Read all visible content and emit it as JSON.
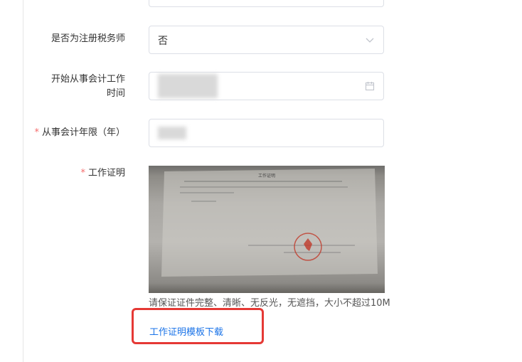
{
  "form": {
    "tax_agent": {
      "label": "是否为注册税务师",
      "value": "否",
      "icon": "chevron-down-icon"
    },
    "start_date": {
      "label_line1": "开始从事会计工作",
      "label_line2": "时间",
      "icon": "calendar-icon"
    },
    "years": {
      "required_mark": "*",
      "label": "从事会计年限（年）"
    },
    "work_cert": {
      "required_mark": "*",
      "label": "工作证明",
      "photo_title": "工作证明",
      "hint": "请保证证件完整、清晰、无反光，无遮挡，大小不超过10M",
      "template_link": "工作证明模板下载"
    }
  },
  "colors": {
    "required": "#f56c6c",
    "link": "#1a73e8",
    "highlight_box": "#e53935",
    "border": "#dcdfe6"
  }
}
